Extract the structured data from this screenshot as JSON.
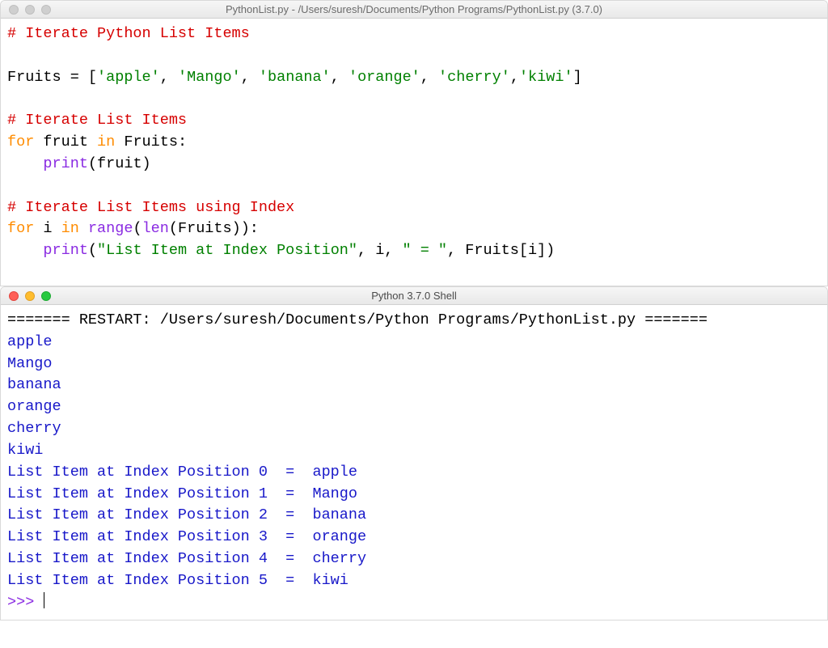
{
  "editor": {
    "title": "PythonList.py - /Users/suresh/Documents/Python Programs/PythonList.py (3.7.0)",
    "code": {
      "l1_comment": "# Iterate Python List Items",
      "l3_var": "Fruits",
      "l3_eq": " = [",
      "l3_s1": "'apple'",
      "l3_c1": ", ",
      "l3_s2": "'Mango'",
      "l3_c2": ", ",
      "l3_s3": "'banana'",
      "l3_c3": ", ",
      "l3_s4": "'orange'",
      "l3_c4": ", ",
      "l3_s5": "'cherry'",
      "l3_c5": ",",
      "l3_s6": "'kiwi'",
      "l3_close": "]",
      "l5_comment": "# Iterate List Items",
      "l6_for": "for",
      "l6_var": " fruit ",
      "l6_in": "in",
      "l6_iter": " Fruits:",
      "l7_indent": "    ",
      "l7_print": "print",
      "l7_arg": "(fruit)",
      "l9_comment": "# Iterate List Items using Index",
      "l10_for": "for",
      "l10_var": " i ",
      "l10_in": "in",
      "l10_sp": " ",
      "l10_range": "range",
      "l10_p1": "(",
      "l10_len": "len",
      "l10_p2": "(Fruits)):",
      "l11_indent": "    ",
      "l11_print": "print",
      "l11_p1": "(",
      "l11_str": "\"List Item at Index Position\"",
      "l11_rest": ", i, ",
      "l11_str2": "\" = \"",
      "l11_rest2": ", Fruits[i])"
    }
  },
  "shell": {
    "title": "Python 3.7.0 Shell",
    "restart": "======= RESTART: /Users/suresh/Documents/Python Programs/PythonList.py =======",
    "output": [
      "apple",
      "Mango",
      "banana",
      "orange",
      "cherry",
      "kiwi",
      "List Item at Index Position 0  =  apple",
      "List Item at Index Position 1  =  Mango",
      "List Item at Index Position 2  =  banana",
      "List Item at Index Position 3  =  orange",
      "List Item at Index Position 4  =  cherry",
      "List Item at Index Position 5  =  kiwi"
    ],
    "prompt": ">>> "
  }
}
